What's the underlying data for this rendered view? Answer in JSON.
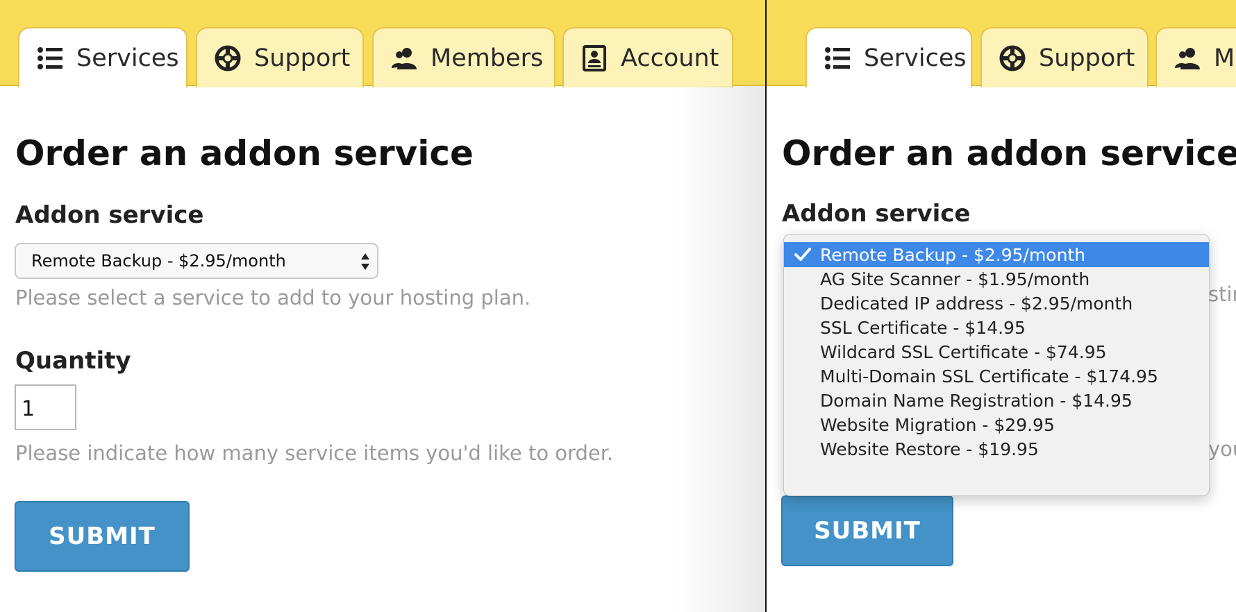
{
  "tabs": [
    {
      "label": "Services",
      "icon": "list-icon"
    },
    {
      "label": "Support",
      "icon": "lifebuoy-icon"
    },
    {
      "label": "Members",
      "icon": "users-icon"
    },
    {
      "label": "Account",
      "icon": "account-card-icon"
    }
  ],
  "form": {
    "title": "Order an addon service",
    "addon_label": "Addon service",
    "addon_selected": "Remote Backup - $2.95/month",
    "addon_help": "Please select a service to add to your hosting plan.",
    "quantity_label": "Quantity",
    "quantity_value": "1",
    "quantity_help": "Please indicate how many service items you'd like to order.",
    "submit_label": "SUBMIT"
  },
  "right_panel": {
    "tab_m_partial": "M",
    "help_fragment_1": "stin",
    "help_fragment_2": "you"
  },
  "dropdown": {
    "options": [
      "Remote Backup - $2.95/month",
      "AG Site Scanner - $1.95/month",
      "Dedicated IP address - $2.95/month",
      "SSL Certificate - $14.95",
      "Wildcard SSL Certificate - $74.95",
      "Multi-Domain SSL Certificate - $174.95",
      "Domain Name Registration - $14.95",
      "Website Migration - $29.95",
      "Website Restore - $19.95"
    ],
    "selected_index": 0
  },
  "colors": {
    "tab_bar": "#f8dc58",
    "tab_inactive": "#fdf3b9",
    "button": "#4492c8",
    "dropdown_highlight": "#3e88e8",
    "help_text": "#9a9a9a"
  }
}
